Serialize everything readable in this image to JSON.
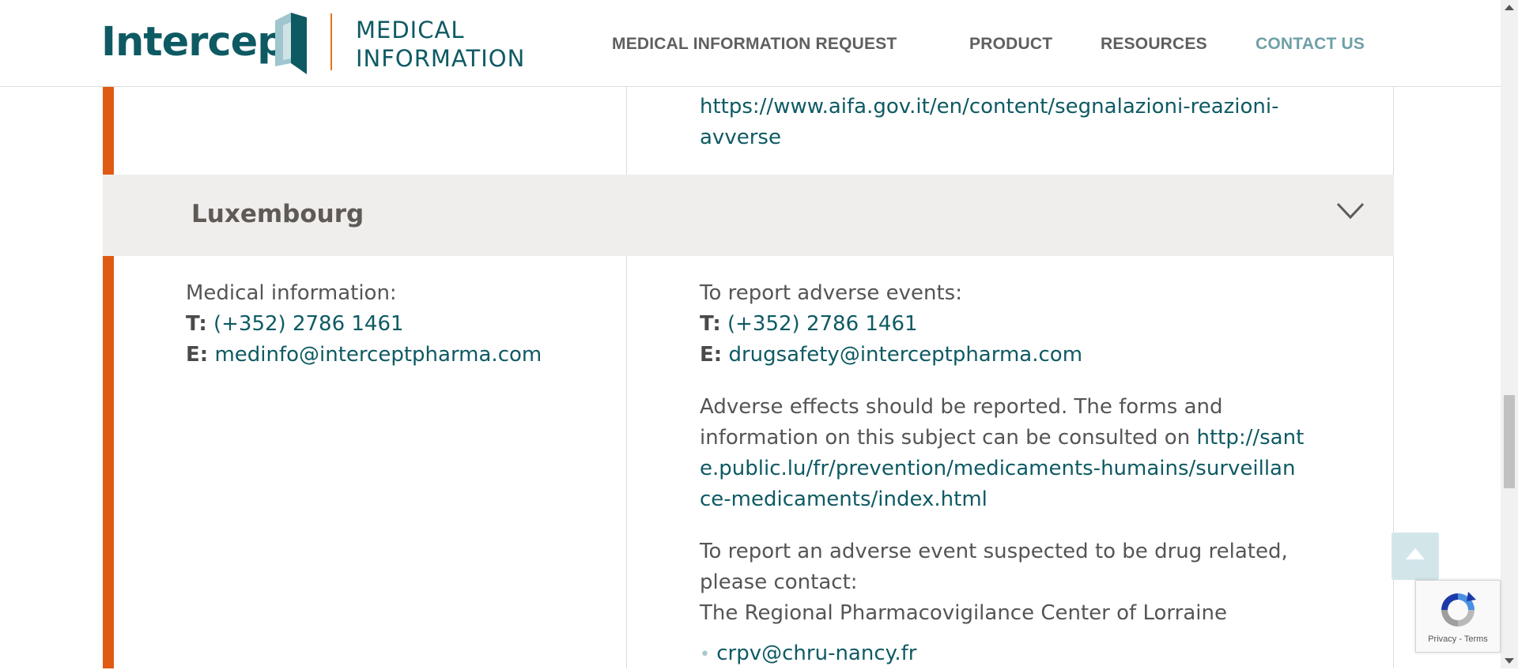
{
  "header": {
    "logo_word": "Intercept",
    "logo_sub_line1": "MEDICAL",
    "logo_sub_line2": "INFORMATION",
    "nav": [
      {
        "label": "MEDICAL INFORMATION REQUEST"
      },
      {
        "label": "PRODUCT"
      },
      {
        "label": "RESOURCES"
      },
      {
        "label": "CONTACT US",
        "active": true
      }
    ]
  },
  "previous_section": {
    "link_line1": "https://www.aifa.gov.it/en/content/segnalazioni-reazioni-",
    "link_line2": "avverse"
  },
  "accordion": {
    "title": "Luxembourg",
    "chevron_icon": "chevron-down-icon"
  },
  "luxembourg": {
    "medical": {
      "heading": "Medical information:",
      "phone_label": "T:",
      "phone": "(+352) 2786 1461",
      "email_label": "E:",
      "email": "medinfo@interceptpharma.com"
    },
    "adverse": {
      "heading": "To report adverse events:",
      "phone_label": "T:",
      "phone": "(+352) 2786 1461",
      "email_label": "E:",
      "email": "drugsafety@interceptpharma.com",
      "para1_line1": "Adverse effects should be reported. The forms and",
      "para1_line2_text": "information on this subject can be consulted on ",
      "para1_line2_link": "http://sant",
      "para1_line3_link": "e.public.lu/fr/prevention/medicaments-humains/surveillan",
      "para1_line4_link": "ce-medicaments/index.html",
      "para2_line1": "To report an adverse event suspected to be drug related,",
      "para2_line2": "please contact:",
      "para2_line3": "The Regional Pharmacovigilance Center of Lorraine",
      "bullet_link": "crpv@chru-nancy.fr"
    }
  },
  "widgets": {
    "back_to_top_icon": "arrow-up-icon",
    "recaptcha_links": "Privacy - Terms"
  },
  "colors": {
    "brand_teal": "#0e5a63",
    "accent_orange": "#e05a14",
    "nav_active": "#6fa0a7",
    "accordion_bg": "#efeeed"
  }
}
